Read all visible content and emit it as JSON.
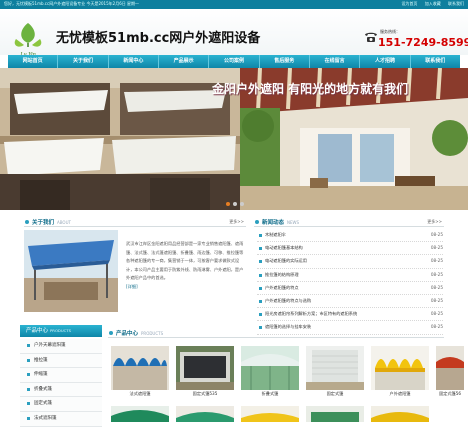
{
  "topbar": {
    "welcome": "您好，无忧模板51mb.cc网户外遮阳设备专业 今天是2015年2月6日 星期一",
    "links": [
      "设为首页",
      "加入收藏",
      "联系我们"
    ]
  },
  "header": {
    "logo_text": "Lu Yin",
    "site_name": "无忧模板51mb.cc网户外遮阳设备",
    "phone_label": "服务热线：",
    "phone": "151-7249-8599"
  },
  "nav": [
    "网站首页",
    "关于我们",
    "新闻中心",
    "产品展示",
    "公司案例",
    "售后服务",
    "在线留言",
    "人才招聘",
    "联系我们"
  ],
  "banner": {
    "slogan": "金阳户外遮阳  有阳光的地方就有我们",
    "dots": 3,
    "active_dot": 0
  },
  "about": {
    "title": "关于我们",
    "title_en": "ABOUT",
    "more": "更多>>",
    "text": "武汉市江岸区金阳遮阳用品经营部是一家专业销售遮阳篷、遮雨篷、法式篷、法式蓬遮阳篷、折叠篷、雨边篷、可移、推拉篷等各种遮阳篷的专一商，集营销于一体，可按客户要求做款式设计，本公司产品主要用于防紫外线、防雨淋雾、户外遮阳，是户外遮阳产品中的首选。",
    "detail": "[详细]"
  },
  "news": {
    "title": "新闻动态",
    "title_en": "NEWS",
    "more": "更多>>",
    "items": [
      {
        "title": "木制遮阳伞",
        "date": "08-25"
      },
      {
        "title": "电动遮阳篷基本结构",
        "date": "08-25"
      },
      {
        "title": "电动遮阳篷的实际运用",
        "date": "08-25"
      },
      {
        "title": "推拉篷的结构原理",
        "date": "08-25"
      },
      {
        "title": "户外遮阳篷的特点",
        "date": "08-25"
      },
      {
        "title": "户外遮阳篷的特点与选购",
        "date": "08-25"
      },
      {
        "title": "阳光房遮阳帘系列解析方案；市区特有的遮阳系统",
        "date": "08-25"
      },
      {
        "title": "遮阳篷的选择与挂车安装",
        "date": "08-25"
      }
    ]
  },
  "sidebar": {
    "title": "产品中心",
    "title_en": "PRODUCTS",
    "items": [
      "户外天幕遮阳篷",
      "推拉篷",
      "伸缩篷",
      "折叠式篷",
      "固定式篷",
      "法式遮阳篷"
    ]
  },
  "products": {
    "title": "产品中心",
    "title_en": "PRODUCTS",
    "items": [
      {
        "caption": "法式遮阳篷"
      },
      {
        "caption": "固定式篷535"
      },
      {
        "caption": "折叠式篷"
      },
      {
        "caption": "固定式篷"
      },
      {
        "caption": "户外遮阳篷"
      },
      {
        "caption": "固定式篷56"
      }
    ]
  },
  "colors": {
    "brand": "#0f86a8",
    "phone": "#d40000",
    "active_dot": "#e67e22"
  }
}
